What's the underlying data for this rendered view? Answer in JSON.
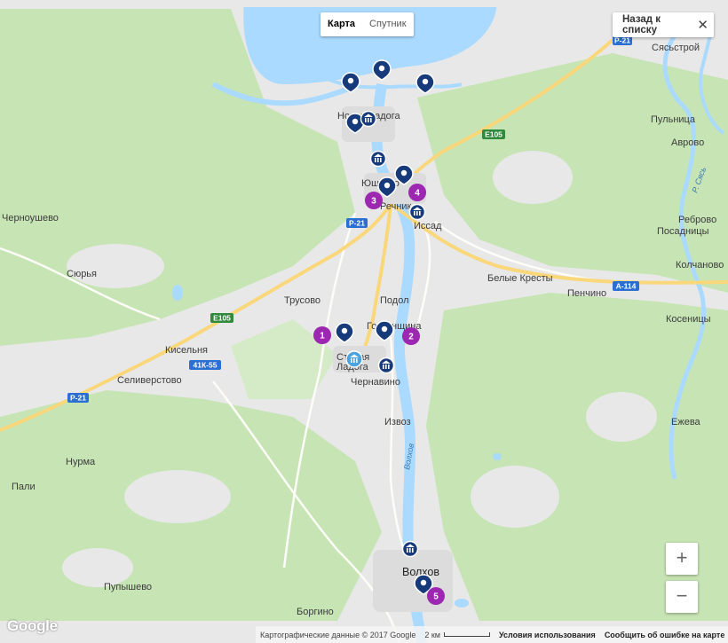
{
  "map_type": {
    "map_label": "Карта",
    "satellite_label": "Спутник",
    "selected": "Карта"
  },
  "back_button": {
    "label": "Назад к списку",
    "close_glyph": "✕"
  },
  "zoom": {
    "in_label": "+",
    "out_label": "−"
  },
  "google_logo": "Google",
  "footer": {
    "map_data": "Картографические данные © 2017 Google",
    "scale": "2 км",
    "terms": "Условия использования",
    "report": "Сообщить об ошибке на карте"
  },
  "places": {
    "novaya_ladoga": "Новая Ладога",
    "yushkovo": "Юшково",
    "rechnik": "Речник",
    "issad": "Иссад",
    "chernoushevo": "Черноушево",
    "syurya": "Сюрья",
    "trusovo": "Трусово",
    "podol": "Подол",
    "gostinopolye": "Гостинщина",
    "staraya_ladoga_1": "Старая",
    "staraya_ladoga_2": "Ладога",
    "chernavino": "Чернавино",
    "kiselnya": "Кисельня",
    "seliverstovo": "Селиверстово",
    "nurma": "Нурма",
    "pali": "Пали",
    "izvoz": "Извоз",
    "volkhov": "Волхов",
    "pupyshevo": "Пупышево",
    "borgino": "Боргино",
    "belye_kresty": "Белые Кресты",
    "penchino": "Пенчино",
    "syasstroy": "Сясьстрой",
    "pulnitsa": "Пульница",
    "avrovo": "Аврово",
    "rebrovo": "Реброво",
    "posadnitsy": "Посадницы",
    "kolchanovo": "Колчаново",
    "kosenitsy": "Косеницы",
    "ezheva": "Ежева",
    "river_volkhov": "Волхов",
    "river_syas": "Р. Сясь"
  },
  "road_shields": {
    "p21_top": "Р-21",
    "e105_top": "E105",
    "p21_mid": "Р-21",
    "e105_mid": "E105",
    "k55": "41К-55",
    "a114": "А-114",
    "p21_left": "Р-21"
  },
  "markers": [
    {
      "num": "1"
    },
    {
      "num": "2"
    },
    {
      "num": "3"
    },
    {
      "num": "4"
    },
    {
      "num": "5"
    }
  ],
  "colors": {
    "water": "#aadaff",
    "land": "#e8e8e8",
    "forest": "#c6e4b4",
    "road": "#fdfcf8",
    "highway": "#f9d77a",
    "marker_purple": "#9c27b0",
    "pin_blue": "#173a7a"
  }
}
